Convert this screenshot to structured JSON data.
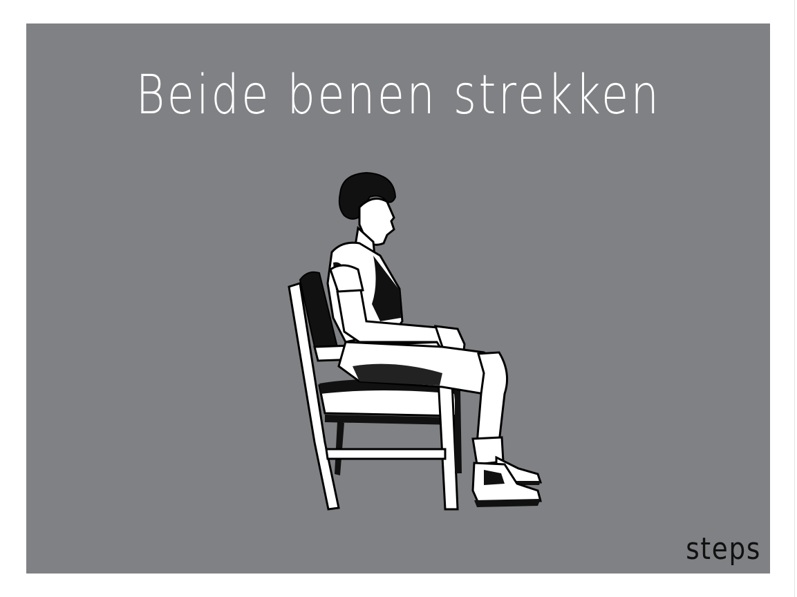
{
  "slide": {
    "title": "Beide benen strekken",
    "illustration": "seated-elderly-person-illustration",
    "brand": "steps"
  },
  "colors": {
    "background": "#808184",
    "page": "#ffffff",
    "title": "#ffffff",
    "brand": "#111111"
  }
}
